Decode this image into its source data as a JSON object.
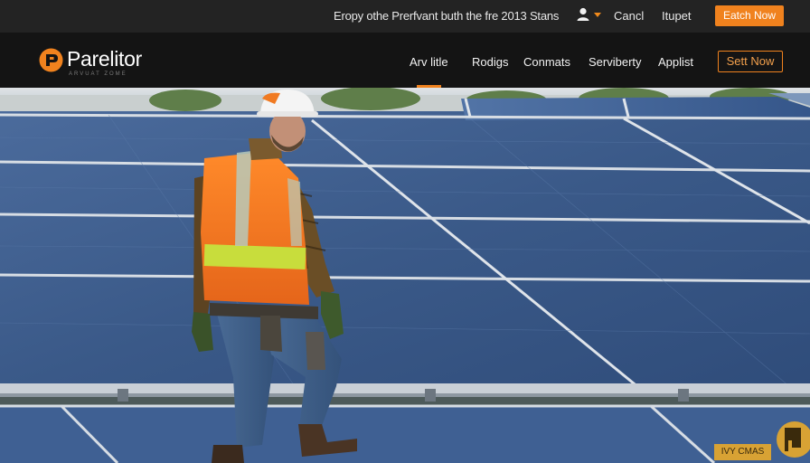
{
  "topbar": {
    "announcement": "Eropy othe Prerfvant buth the fre 2013 Stans",
    "user_icon": "user-icon",
    "cancel_label": "Cancl",
    "support_label": "Itupet",
    "cta_label": "Eatch Now"
  },
  "nav": {
    "logo_text": "Parelitor",
    "logo_tagline": "ARVUAT ZOME",
    "items": [
      {
        "label": "Arv litle",
        "active": true
      },
      {
        "label": "Rodigs",
        "active": false
      },
      {
        "label": "Conmats",
        "active": false
      },
      {
        "label": "Serviberty",
        "active": false
      },
      {
        "label": "Applist",
        "active": false
      }
    ],
    "cta_label": "Sett Now"
  },
  "hero": {
    "image": "worker-walking-on-solar-panels",
    "badge_text": "IVY CMAS",
    "corner_icon": "brand-mark-icon"
  },
  "colors": {
    "accent": "#f0821e",
    "topbar_bg": "#232323",
    "nav_bg": "#141414",
    "panel_blue": "#3d5c8c"
  }
}
